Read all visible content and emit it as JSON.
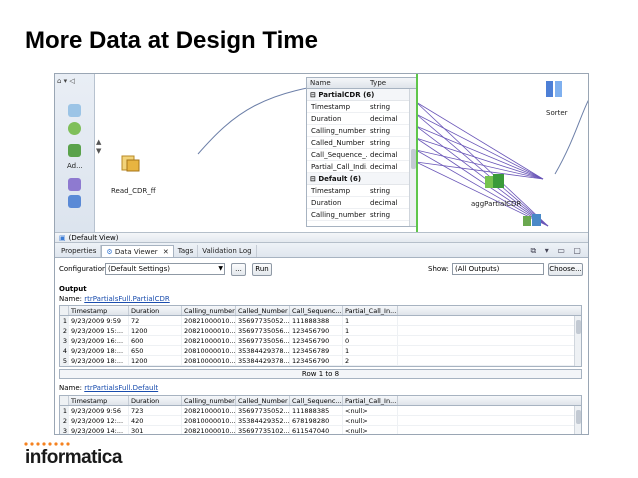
{
  "slide": {
    "title": "More Data at Design Time"
  },
  "canvas": {
    "palette_items": [
      "Ad..."
    ],
    "nodes": {
      "read_label": "Read_CDR_ff",
      "sorter_label": "Sorter",
      "agg_label": "aggPartialCDR"
    },
    "port_table": {
      "headers": [
        "Name",
        "Type"
      ],
      "groups": [
        {
          "label": "PartialCDR (6)",
          "rows": [
            [
              "Timestamp",
              "string"
            ],
            [
              "Duration",
              "decimal"
            ],
            [
              "Calling_number",
              "string"
            ],
            [
              "Called_Number",
              "string"
            ],
            [
              "Call_Sequence_...",
              "decimal"
            ],
            [
              "Partial_Call_Indi...",
              "decimal"
            ]
          ]
        },
        {
          "label": "Default (6)",
          "rows": [
            [
              "Timestamp",
              "string"
            ],
            [
              "Duration",
              "decimal"
            ],
            [
              "Calling_number",
              "string"
            ]
          ]
        }
      ]
    },
    "default_view": "(Default View)"
  },
  "tabs": [
    {
      "label": "Properties",
      "active": false
    },
    {
      "label": "Data Viewer",
      "active": true
    },
    {
      "label": "Tags",
      "active": false
    },
    {
      "label": "Validation Log",
      "active": false
    }
  ],
  "config": {
    "label": "Configuration:",
    "value": "(Default Settings)",
    "more": "...",
    "run": "Run",
    "show_label": "Show:",
    "show_value": "(All Outputs)",
    "choose": "Choose..."
  },
  "output": {
    "title": "Output",
    "name_label": "Name:",
    "table1_name": "rtrPartialsFull.PartialCDR",
    "table2_name": "rtrPartialsFull.Default",
    "columns": [
      "Timestamp",
      "Duration",
      "Calling_number",
      "Called_Number",
      "Call_Sequenc...",
      "Partial_Call_In..."
    ],
    "table1_rows": [
      [
        "1",
        "9/23/2009 9:59",
        "72",
        "20821000010...",
        "35697735052...",
        "111888388",
        "1"
      ],
      [
        "2",
        "9/23/2009 15:...",
        "1200",
        "20821000010...",
        "35697735056...",
        "123456790",
        "1"
      ],
      [
        "3",
        "9/23/2009 16:...",
        "600",
        "20821000010...",
        "35697735056...",
        "123456790",
        "0"
      ],
      [
        "4",
        "9/23/2009 18:...",
        "650",
        "20810000010...",
        "35384429378...",
        "123456789",
        "1"
      ],
      [
        "5",
        "9/23/2009 18:...",
        "1200",
        "20810000010...",
        "35384429378...",
        "123456790",
        "2"
      ]
    ],
    "pager": "Row 1 to 8",
    "table2_rows": [
      [
        "1",
        "9/23/2009 9:56",
        "723",
        "20821000010...",
        "35697735052...",
        "111888385",
        "<null>"
      ],
      [
        "2",
        "9/23/2009 12:...",
        "420",
        "20810000010...",
        "35384429352...",
        "678198280",
        "<null>"
      ],
      [
        "3",
        "9/23/2009 14:...",
        "301",
        "20821000010...",
        "35697735102...",
        "611547040",
        "<null>"
      ]
    ]
  },
  "logo": {
    "text": "informatica"
  }
}
